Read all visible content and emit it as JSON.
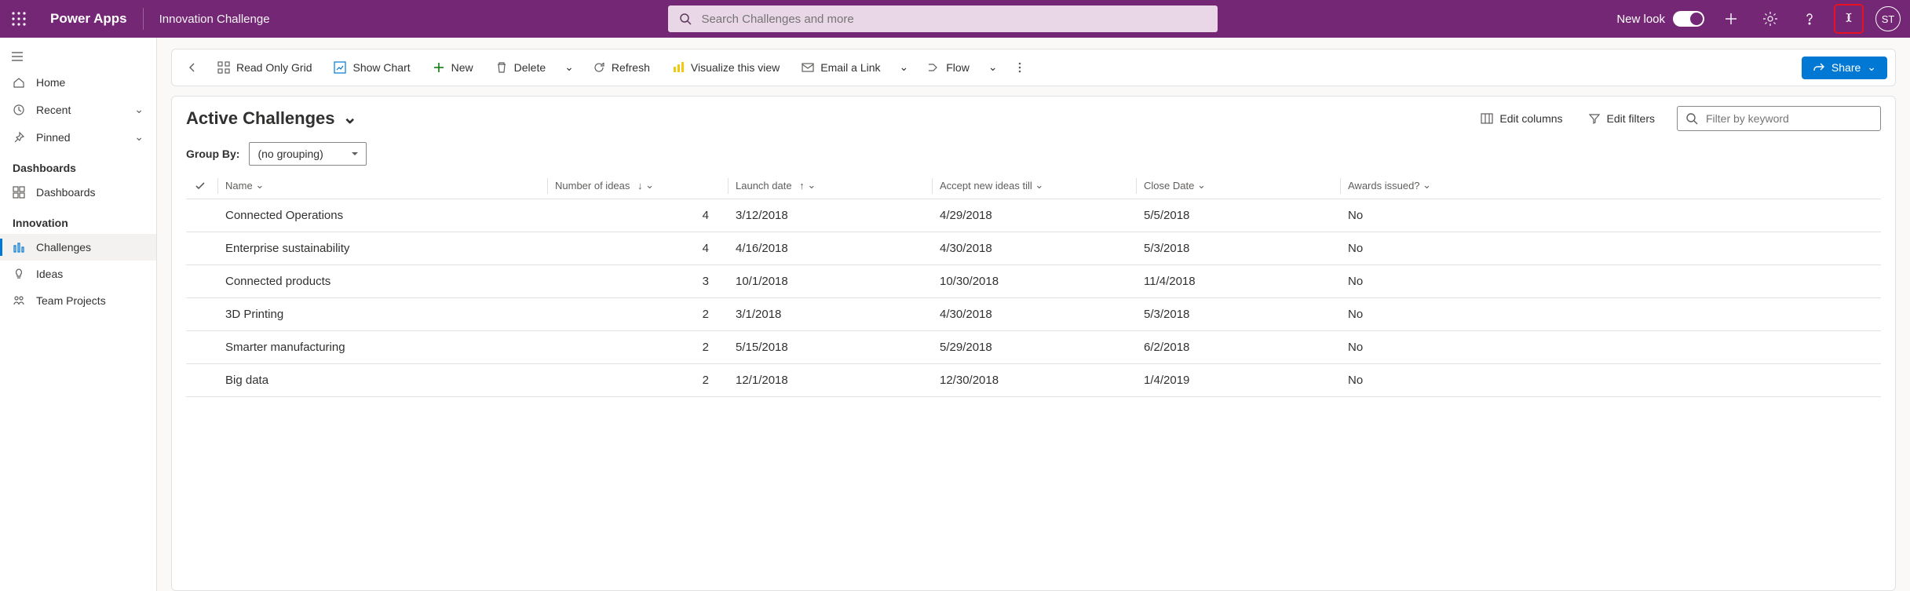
{
  "top": {
    "brand": "Power Apps",
    "app_name": "Innovation Challenge",
    "search_placeholder": "Search Challenges and more",
    "new_look_label": "New look",
    "avatar_initials": "ST"
  },
  "sidebar": {
    "home": "Home",
    "recent": "Recent",
    "pinned": "Pinned",
    "group_dashboards": "Dashboards",
    "dashboards": "Dashboards",
    "group_innovation": "Innovation",
    "challenges": "Challenges",
    "ideas": "Ideas",
    "team_projects": "Team Projects"
  },
  "commands": {
    "read_only_grid": "Read Only Grid",
    "show_chart": "Show Chart",
    "new": "New",
    "delete": "Delete",
    "refresh": "Refresh",
    "visualize": "Visualize this view",
    "email": "Email a Link",
    "flow": "Flow",
    "share": "Share"
  },
  "view": {
    "title": "Active Challenges",
    "edit_columns": "Edit columns",
    "edit_filters": "Edit filters",
    "filter_placeholder": "Filter by keyword",
    "group_by_label": "Group By:",
    "group_by_value": "(no grouping)"
  },
  "columns": {
    "name": "Name",
    "num_ideas": "Number of ideas",
    "launch": "Launch date",
    "accept_until": "Accept new ideas till",
    "close": "Close Date",
    "awards": "Awards issued?"
  },
  "rows": [
    {
      "name": "Connected Operations",
      "ideas": "4",
      "launch": "3/12/2018",
      "accept": "4/29/2018",
      "close": "5/5/2018",
      "awards": "No"
    },
    {
      "name": "Enterprise sustainability",
      "ideas": "4",
      "launch": "4/16/2018",
      "accept": "4/30/2018",
      "close": "5/3/2018",
      "awards": "No"
    },
    {
      "name": "Connected products",
      "ideas": "3",
      "launch": "10/1/2018",
      "accept": "10/30/2018",
      "close": "11/4/2018",
      "awards": "No"
    },
    {
      "name": "3D Printing",
      "ideas": "2",
      "launch": "3/1/2018",
      "accept": "4/30/2018",
      "close": "5/3/2018",
      "awards": "No"
    },
    {
      "name": "Smarter manufacturing",
      "ideas": "2",
      "launch": "5/15/2018",
      "accept": "5/29/2018",
      "close": "6/2/2018",
      "awards": "No"
    },
    {
      "name": "Big data",
      "ideas": "2",
      "launch": "12/1/2018",
      "accept": "12/30/2018",
      "close": "1/4/2019",
      "awards": "No"
    }
  ]
}
